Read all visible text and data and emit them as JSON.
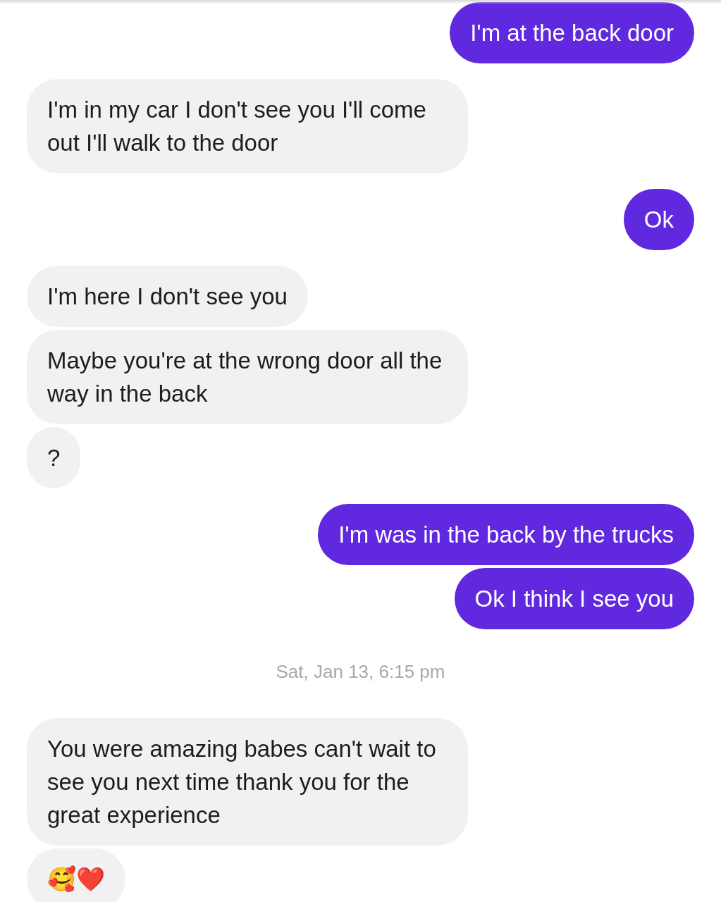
{
  "messages": [
    {
      "kind": "sent",
      "text": "I'm at the back door"
    },
    {
      "kind": "received",
      "text": "I'm in my car I don't see you I'll come out I'll walk to the door"
    },
    {
      "kind": "sent",
      "text": "Ok"
    },
    {
      "kind": "received",
      "text": "I'm here I don't see you"
    },
    {
      "kind": "received",
      "text": "Maybe you're at the wrong door all the way in the back"
    },
    {
      "kind": "received",
      "text": "?"
    },
    {
      "kind": "sent",
      "text": "I'm was in the back by the trucks"
    },
    {
      "kind": "sent",
      "text": "Ok I think I see you"
    },
    {
      "kind": "timestamp",
      "text": "Sat, Jan 13, 6:15 pm"
    },
    {
      "kind": "received",
      "text": "You were amazing babes can't wait to see you next time thank you for the great experience"
    },
    {
      "kind": "received",
      "text": "🥰❤️"
    }
  ]
}
